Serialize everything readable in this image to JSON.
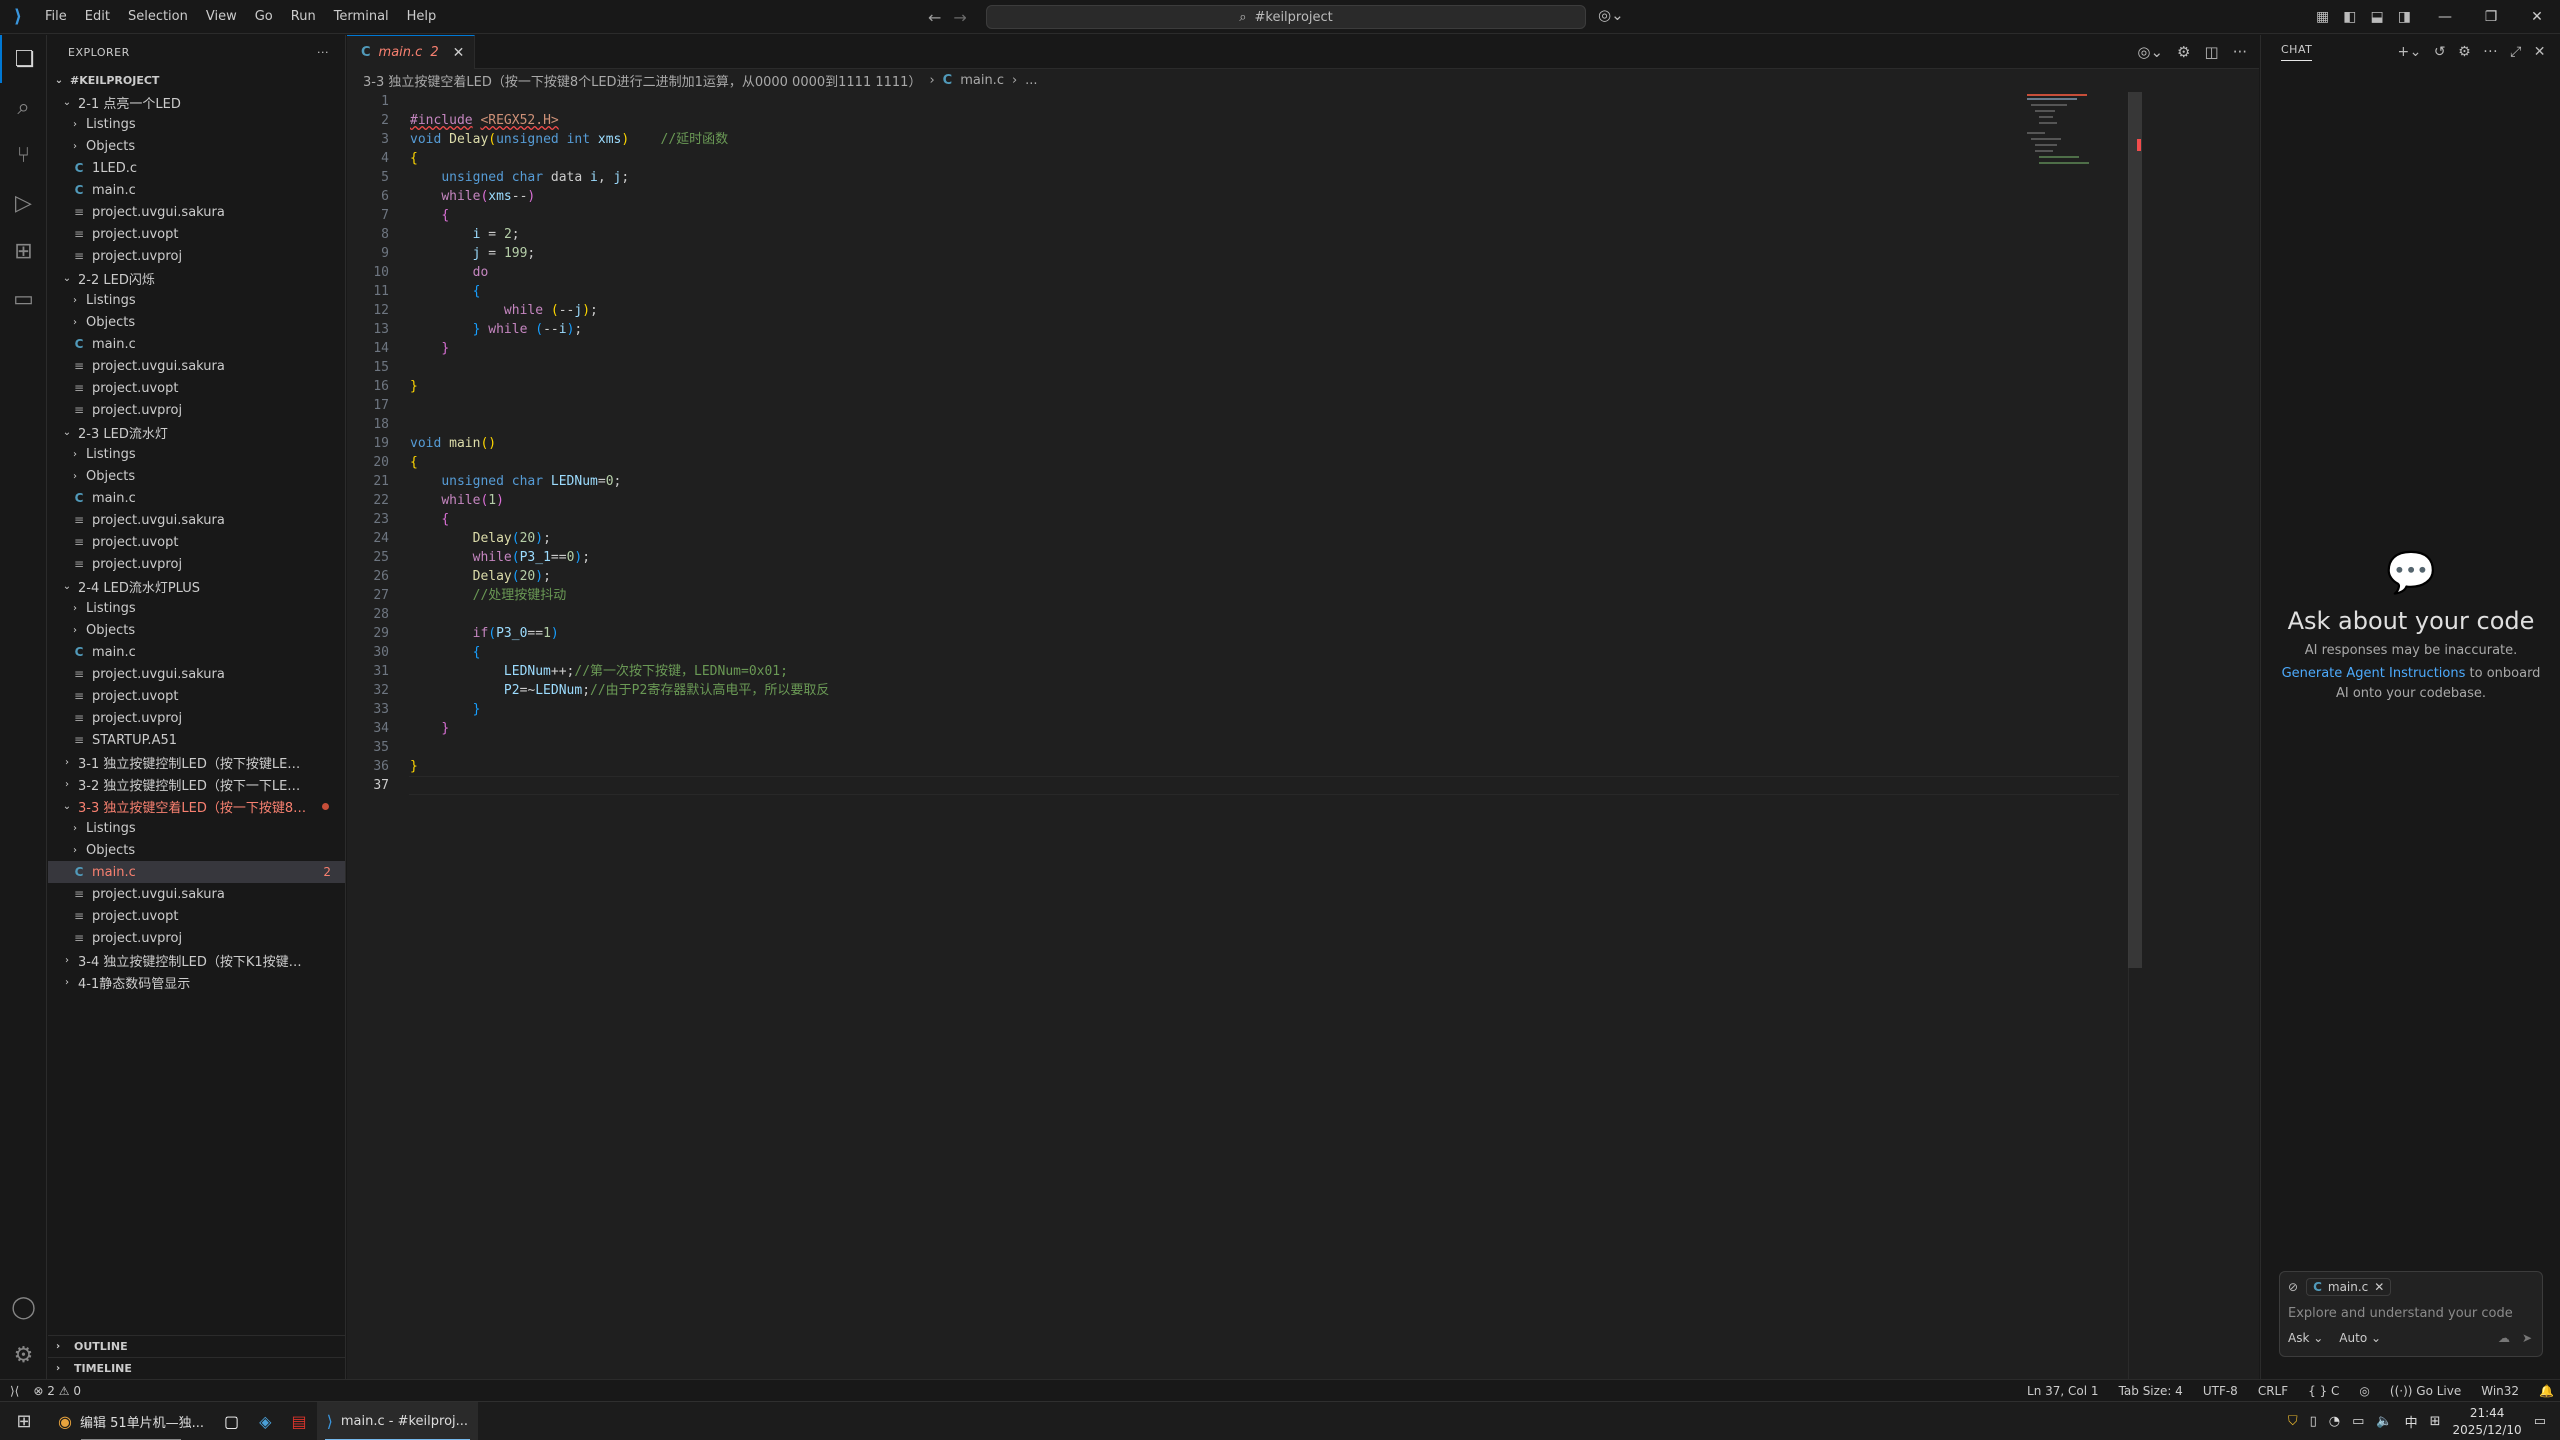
{
  "titlebar": {
    "menu": [
      "File",
      "Edit",
      "Selection",
      "View",
      "Go",
      "Run",
      "Terminal",
      "Help"
    ],
    "search_text": "#keilproject"
  },
  "sidebar": {
    "header": "EXPLORER",
    "root": "#KEILPROJECT",
    "tree": [
      {
        "label": "2-1 点亮一个LED",
        "depth": 1,
        "type": "folder-open"
      },
      {
        "label": "Listings",
        "depth": 2,
        "type": "folder"
      },
      {
        "label": "Objects",
        "depth": 2,
        "type": "folder"
      },
      {
        "label": "1LED.c",
        "depth": 2,
        "type": "c"
      },
      {
        "label": "main.c",
        "depth": 2,
        "type": "c"
      },
      {
        "label": "project.uvgui.sakura",
        "depth": 2,
        "type": "file"
      },
      {
        "label": "project.uvopt",
        "depth": 2,
        "type": "file"
      },
      {
        "label": "project.uvproj",
        "depth": 2,
        "type": "file"
      },
      {
        "label": "2-2 LED闪烁",
        "depth": 1,
        "type": "folder-open"
      },
      {
        "label": "Listings",
        "depth": 2,
        "type": "folder"
      },
      {
        "label": "Objects",
        "depth": 2,
        "type": "folder"
      },
      {
        "label": "main.c",
        "depth": 2,
        "type": "c"
      },
      {
        "label": "project.uvgui.sakura",
        "depth": 2,
        "type": "file"
      },
      {
        "label": "project.uvopt",
        "depth": 2,
        "type": "file"
      },
      {
        "label": "project.uvproj",
        "depth": 2,
        "type": "file"
      },
      {
        "label": "2-3 LED流水灯",
        "depth": 1,
        "type": "folder-open"
      },
      {
        "label": "Listings",
        "depth": 2,
        "type": "folder"
      },
      {
        "label": "Objects",
        "depth": 2,
        "type": "folder"
      },
      {
        "label": "main.c",
        "depth": 2,
        "type": "c"
      },
      {
        "label": "project.uvgui.sakura",
        "depth": 2,
        "type": "file"
      },
      {
        "label": "project.uvopt",
        "depth": 2,
        "type": "file"
      },
      {
        "label": "project.uvproj",
        "depth": 2,
        "type": "file"
      },
      {
        "label": "2-4 LED流水灯PLUS",
        "depth": 1,
        "type": "folder-open"
      },
      {
        "label": "Listings",
        "depth": 2,
        "type": "folder"
      },
      {
        "label": "Objects",
        "depth": 2,
        "type": "folder"
      },
      {
        "label": "main.c",
        "depth": 2,
        "type": "c"
      },
      {
        "label": "project.uvgui.sakura",
        "depth": 2,
        "type": "file"
      },
      {
        "label": "project.uvopt",
        "depth": 2,
        "type": "file"
      },
      {
        "label": "project.uvproj",
        "depth": 2,
        "type": "file"
      },
      {
        "label": "STARTUP.A51",
        "depth": 2,
        "type": "file"
      },
      {
        "label": "3-1 独立按键控制LED（按下按键LED亮，松...",
        "depth": 1,
        "type": "folder"
      },
      {
        "label": "3-2 独立按键控制LED（按下一下LED亮，再按...",
        "depth": 1,
        "type": "folder"
      },
      {
        "label": "3-3 独立按键空着LED（按一下按键8个...",
        "depth": 1,
        "type": "folder-open",
        "error": true,
        "dot": true
      },
      {
        "label": "Listings",
        "depth": 2,
        "type": "folder"
      },
      {
        "label": "Objects",
        "depth": 2,
        "type": "folder"
      },
      {
        "label": "main.c",
        "depth": 2,
        "type": "c",
        "selected": true,
        "error": true,
        "badge": "2"
      },
      {
        "label": "project.uvgui.sakura",
        "depth": 2,
        "type": "file"
      },
      {
        "label": "project.uvopt",
        "depth": 2,
        "type": "file"
      },
      {
        "label": "project.uvproj",
        "depth": 2,
        "type": "file"
      },
      {
        "label": "3-4 独立按键控制LED（按下K1按键，LED亮...",
        "depth": 1,
        "type": "folder"
      },
      {
        "label": "4-1静态数码管显示",
        "depth": 1,
        "type": "folder"
      }
    ],
    "sections": [
      "OUTLINE",
      "TIMELINE"
    ]
  },
  "editor": {
    "tab": {
      "label": "main.c",
      "badge": "2"
    },
    "breadcrumb": {
      "folder": "3-3 独立按键空着LED（按一下按键8个LED进行二进制加1运算，从0000 0000到1111 1111）",
      "file": "main.c",
      "more": "..."
    },
    "current_line": 37
  },
  "chat": {
    "header": "CHAT",
    "heading": "Ask about your code",
    "subtext": "AI responses may be inaccurate.",
    "link": "Generate Agent Instructions",
    "link_suffix": "to onboard AI onto your codebase.",
    "context_file": "main.c",
    "placeholder": "Explore and understand your code",
    "mode": "Ask",
    "model": "Auto"
  },
  "statusbar": {
    "errors": "2",
    "warnings": "0",
    "position": "Ln 37, Col 1",
    "tab_size": "Tab Size: 4",
    "encoding": "UTF-8",
    "eol": "CRLF",
    "language": "C",
    "go_live": "Go Live",
    "platform": "Win32"
  },
  "taskbar": {
    "apps": [
      {
        "name": "chrome",
        "label": "编辑 51单片机—独..."
      },
      {
        "name": "notepad",
        "label": ""
      },
      {
        "name": "keil",
        "label": ""
      },
      {
        "name": "app-red",
        "label": ""
      },
      {
        "name": "vscode",
        "label": "main.c - #keilproj..."
      }
    ],
    "ime": "中",
    "time": "21:44",
    "date": "2025/12/10"
  }
}
